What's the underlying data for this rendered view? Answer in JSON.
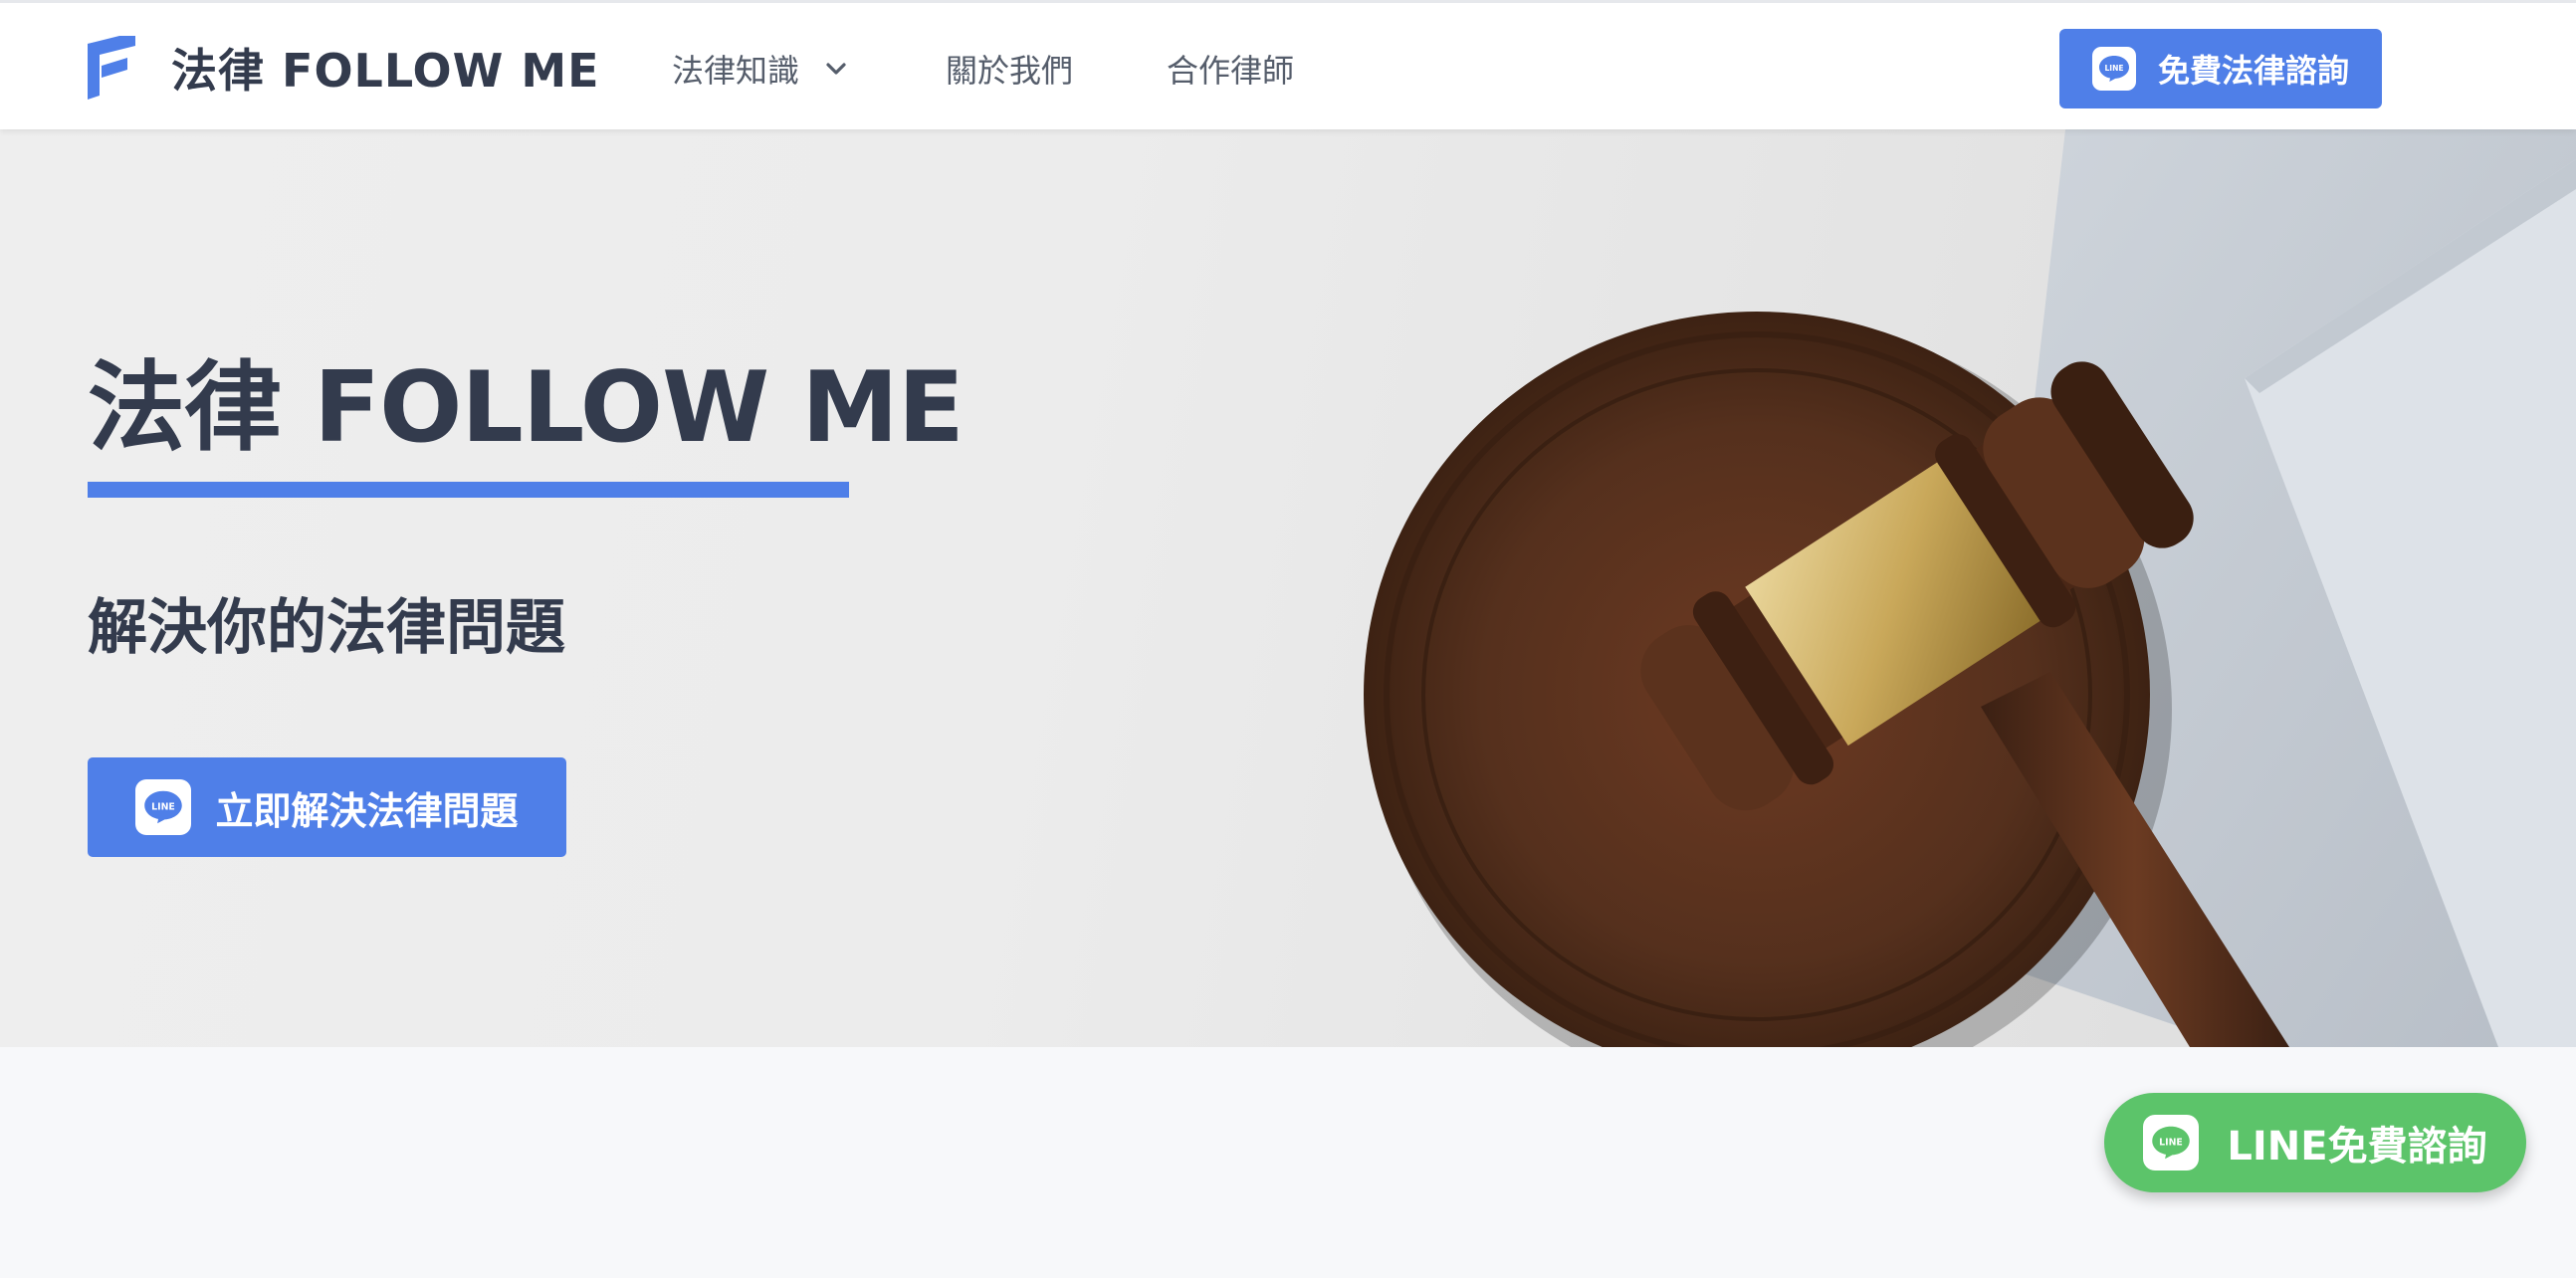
{
  "header": {
    "brand_name": "法律 FOLLOW ME",
    "nav": {
      "knowledge": "法律知識",
      "about": "關於我們",
      "lawyers": "合作律師"
    },
    "cta_label": "免費法律諮詢"
  },
  "hero": {
    "title": "法律 FOLLOW ME",
    "subtitle": "解決你的法律問題",
    "cta_label": "立即解決法律問題"
  },
  "floating_button": {
    "label": "LINE免費諮詢"
  },
  "icons": {
    "logo": "brand-f-icon",
    "dropdown": "chevron-down-icon",
    "line": "line-icon"
  },
  "colors": {
    "accent_blue": "#4f7fe8",
    "line_green": "#5cc46a",
    "text_dark": "#333b4d",
    "nav_text": "#555d6b",
    "header_bg": "#ffffff",
    "page_bg": "#f7f8fa"
  }
}
